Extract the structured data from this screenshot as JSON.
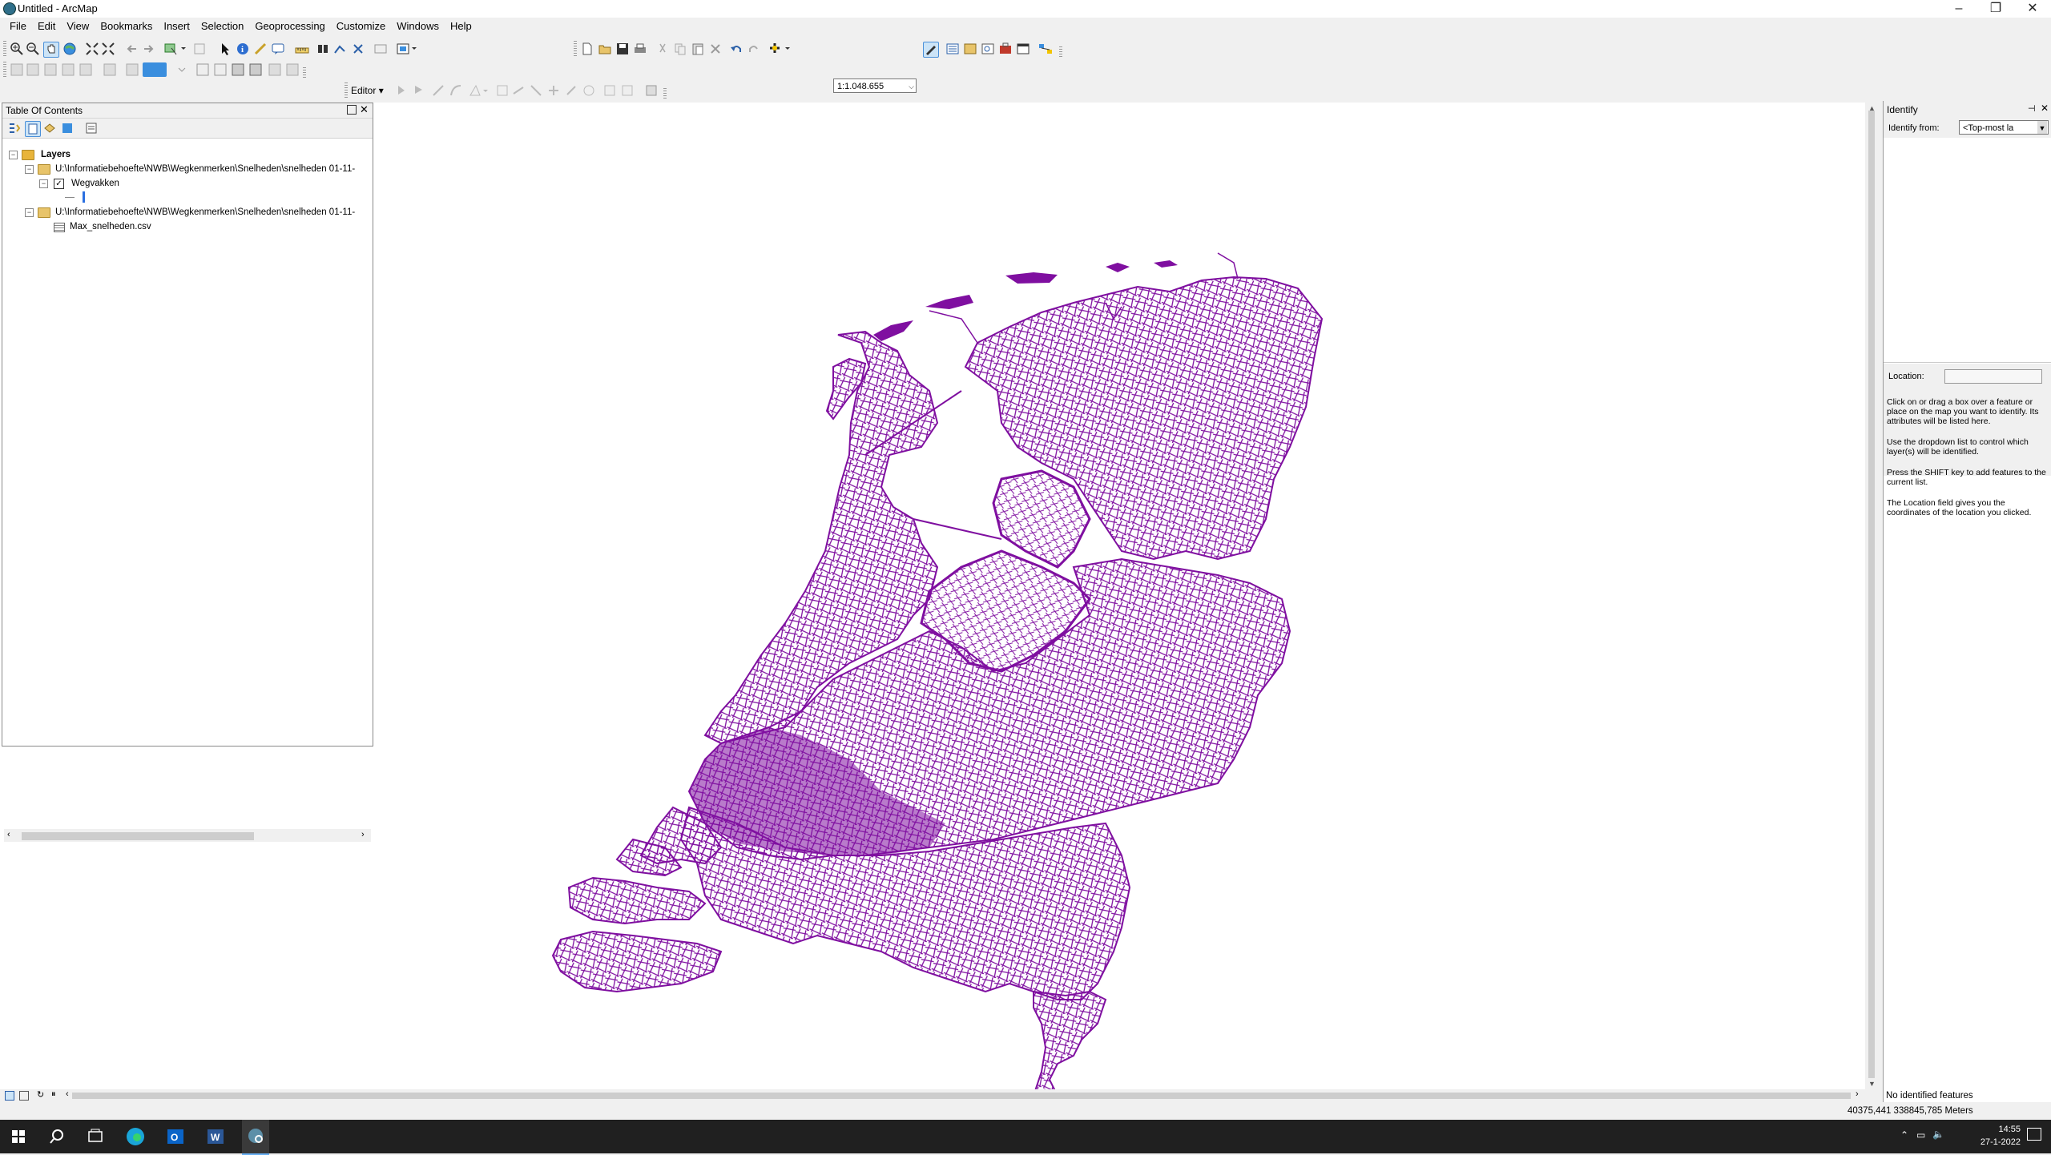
{
  "window": {
    "title": "Untitled - ArcMap"
  },
  "menu": [
    "File",
    "Edit",
    "View",
    "Bookmarks",
    "Insert",
    "Selection",
    "Geoprocessing",
    "Customize",
    "Windows",
    "Help"
  ],
  "toolbar": {
    "scale": "1:1.048.655",
    "editor_label": "Editor"
  },
  "toc": {
    "title": "Table Of Contents",
    "root_label": "Layers",
    "layers": [
      {
        "path": "U:\\Informatiebehoefte\\NWB\\Wegkenmerken\\Snelheden\\snelheden 01-11-",
        "child": "Wegvakken",
        "checked": true
      },
      {
        "path": "U:\\Informatiebehoefte\\NWB\\Wegkenmerken\\Snelheden\\snelheden 01-11-",
        "child": "Max_snelheden.csv"
      }
    ]
  },
  "map": {
    "line_color": "#7f0fa0"
  },
  "identify": {
    "title": "Identify",
    "from_label": "Identify from:",
    "from_value": "<Top-most la",
    "location_label": "Location:",
    "help": [
      "Click on or drag a box over a feature or place on the map you want to identify. Its attributes will be listed here.",
      "Use the dropdown list to control which layer(s) will be identified.",
      "Press the SHIFT key to add features to the current list.",
      "The Location field gives you the coordinates of the location you clicked."
    ],
    "status": "No identified features"
  },
  "statusbar": {
    "coords": "40375,441  338845,785 Meters"
  },
  "taskbar": {
    "time": "14:55",
    "date": "27-1-2022"
  }
}
